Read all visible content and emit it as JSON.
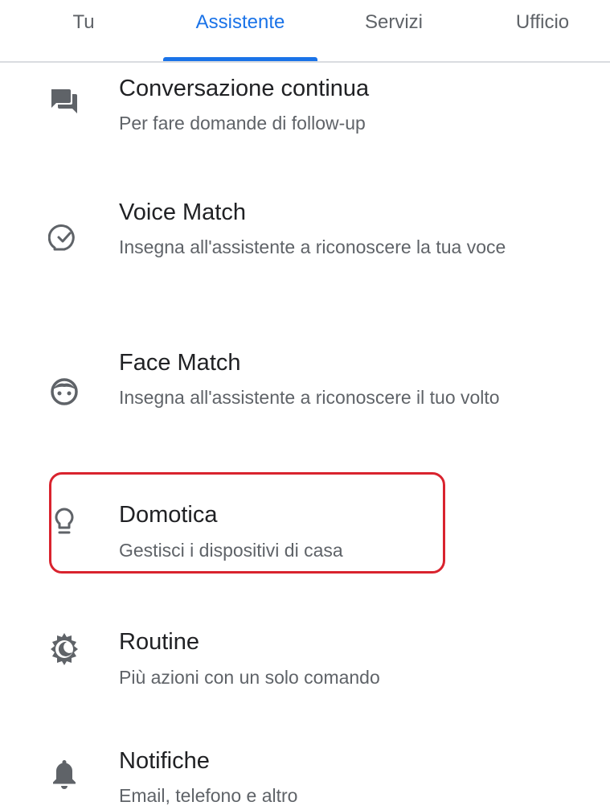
{
  "tabs": [
    {
      "label": "Tu",
      "active": false
    },
    {
      "label": "Assistente",
      "active": true
    },
    {
      "label": "Servizi",
      "active": false
    },
    {
      "label": "Ufficio",
      "active": false
    }
  ],
  "accent_color": "#1a73e8",
  "highlight_color": "#d9232e",
  "items": [
    {
      "title": "Conversazione continua",
      "subtitle": "Per fare domande di follow-up",
      "icon": "chat-icon"
    },
    {
      "title": "Voice Match",
      "subtitle": "Insegna all'assistente a riconoscere la tua voce",
      "icon": "voice-match-icon"
    },
    {
      "title": "Face Match",
      "subtitle": "Insegna all'assistente a riconoscere il tuo volto",
      "icon": "face-icon"
    },
    {
      "title": "Domotica",
      "subtitle": "Gestisci i dispositivi di casa",
      "icon": "lightbulb-icon",
      "highlighted": true
    },
    {
      "title": "Routine",
      "subtitle": "Più azioni con un solo comando",
      "icon": "routine-icon"
    },
    {
      "title": "Notifiche",
      "subtitle": "Email, telefono e altro",
      "icon": "bell-icon"
    }
  ]
}
